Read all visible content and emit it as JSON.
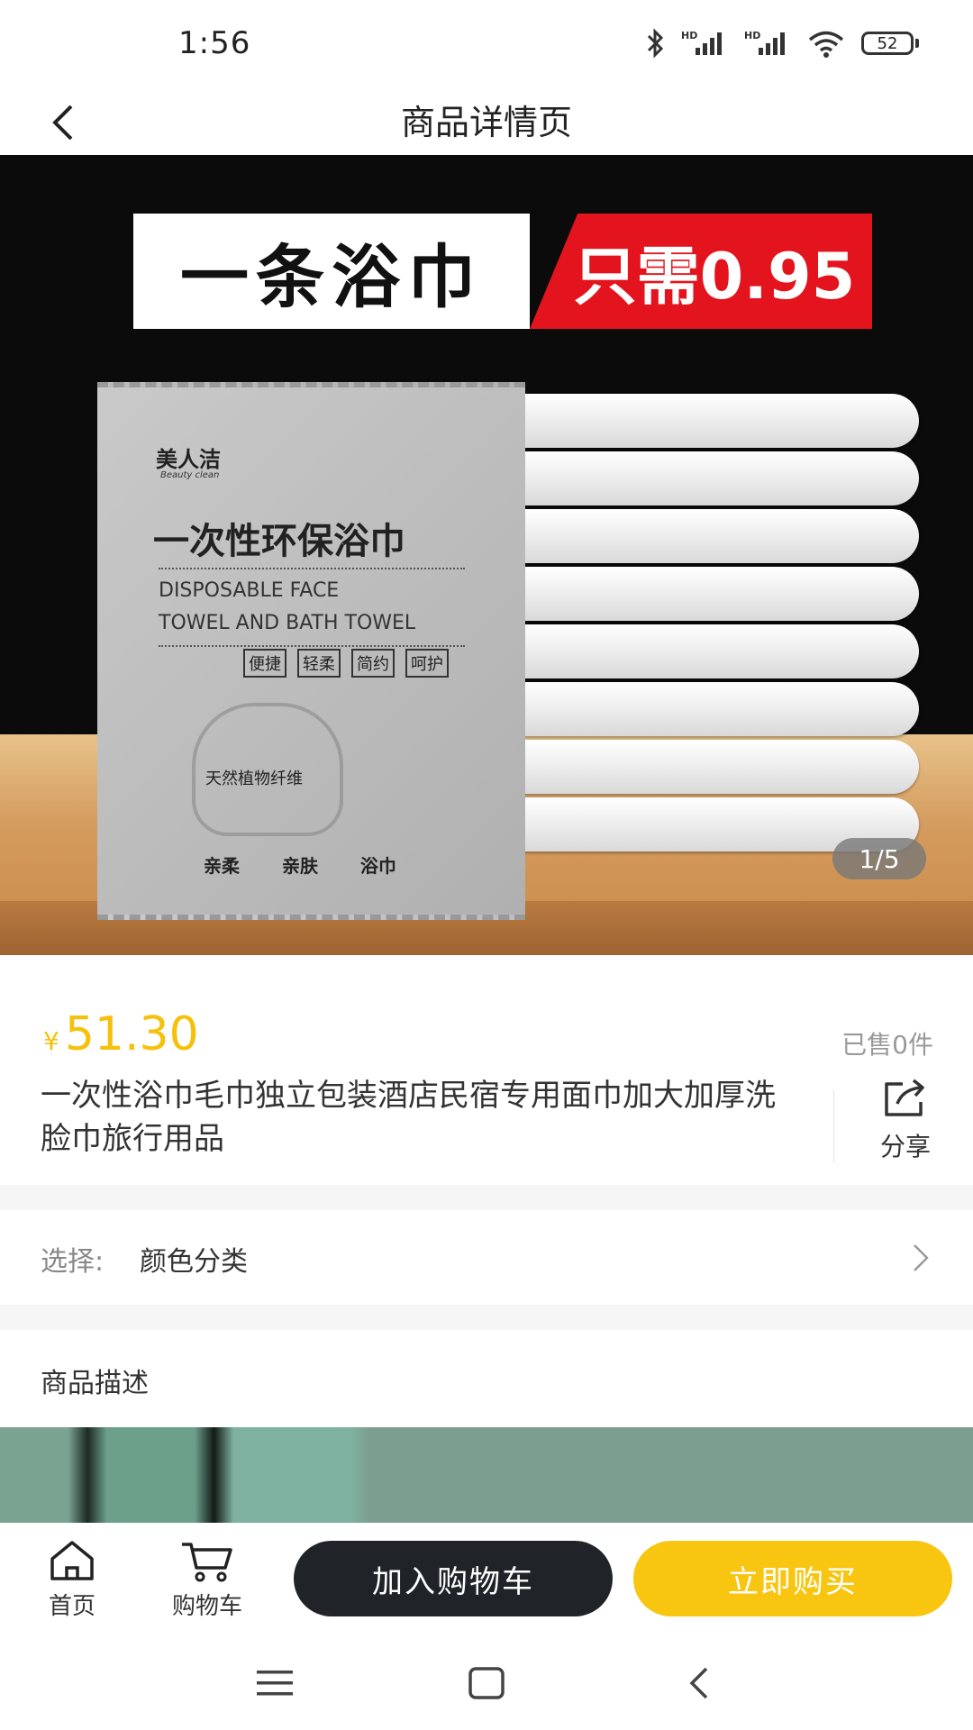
{
  "status_bar": {
    "time": "1:56",
    "battery": "52"
  },
  "nav": {
    "title": "商品详情页"
  },
  "hero": {
    "banner_left": "一条浴巾",
    "banner_right": "只需0.95",
    "pack_brand": "美人洁",
    "pack_brand_sub": "Beauty clean",
    "pack_title": "一次性环保浴巾",
    "pack_en_line1": "DISPOSABLE FACE",
    "pack_en_line2": "TOWEL AND BATH TOWEL",
    "pack_tags": [
      "便捷",
      "轻柔",
      "简约",
      "呵护"
    ],
    "pack_fiber": "天然植物纤维",
    "pack_bottom": "亲柔 亲肤 浴巾",
    "page_indicator": "1/5"
  },
  "product": {
    "price_symbol": "¥",
    "price": "51.30",
    "sold": "已售0件",
    "title": "一次性浴巾毛巾独立包装酒店民宿专用面巾加大加厚洗脸巾旅行用品",
    "share_label": "分享"
  },
  "spec": {
    "prefix": "选择:",
    "value": "颜色分类"
  },
  "description": {
    "title": "商品描述"
  },
  "bottom_bar": {
    "home_label": "首页",
    "cart_label": "购物车",
    "add_to_cart": "加入购物车",
    "buy_now": "立即购买"
  },
  "colors": {
    "price": "#f5c10d",
    "buy_button": "#f8c511",
    "cart_button": "#202429",
    "banner_red": "#e3141d"
  }
}
